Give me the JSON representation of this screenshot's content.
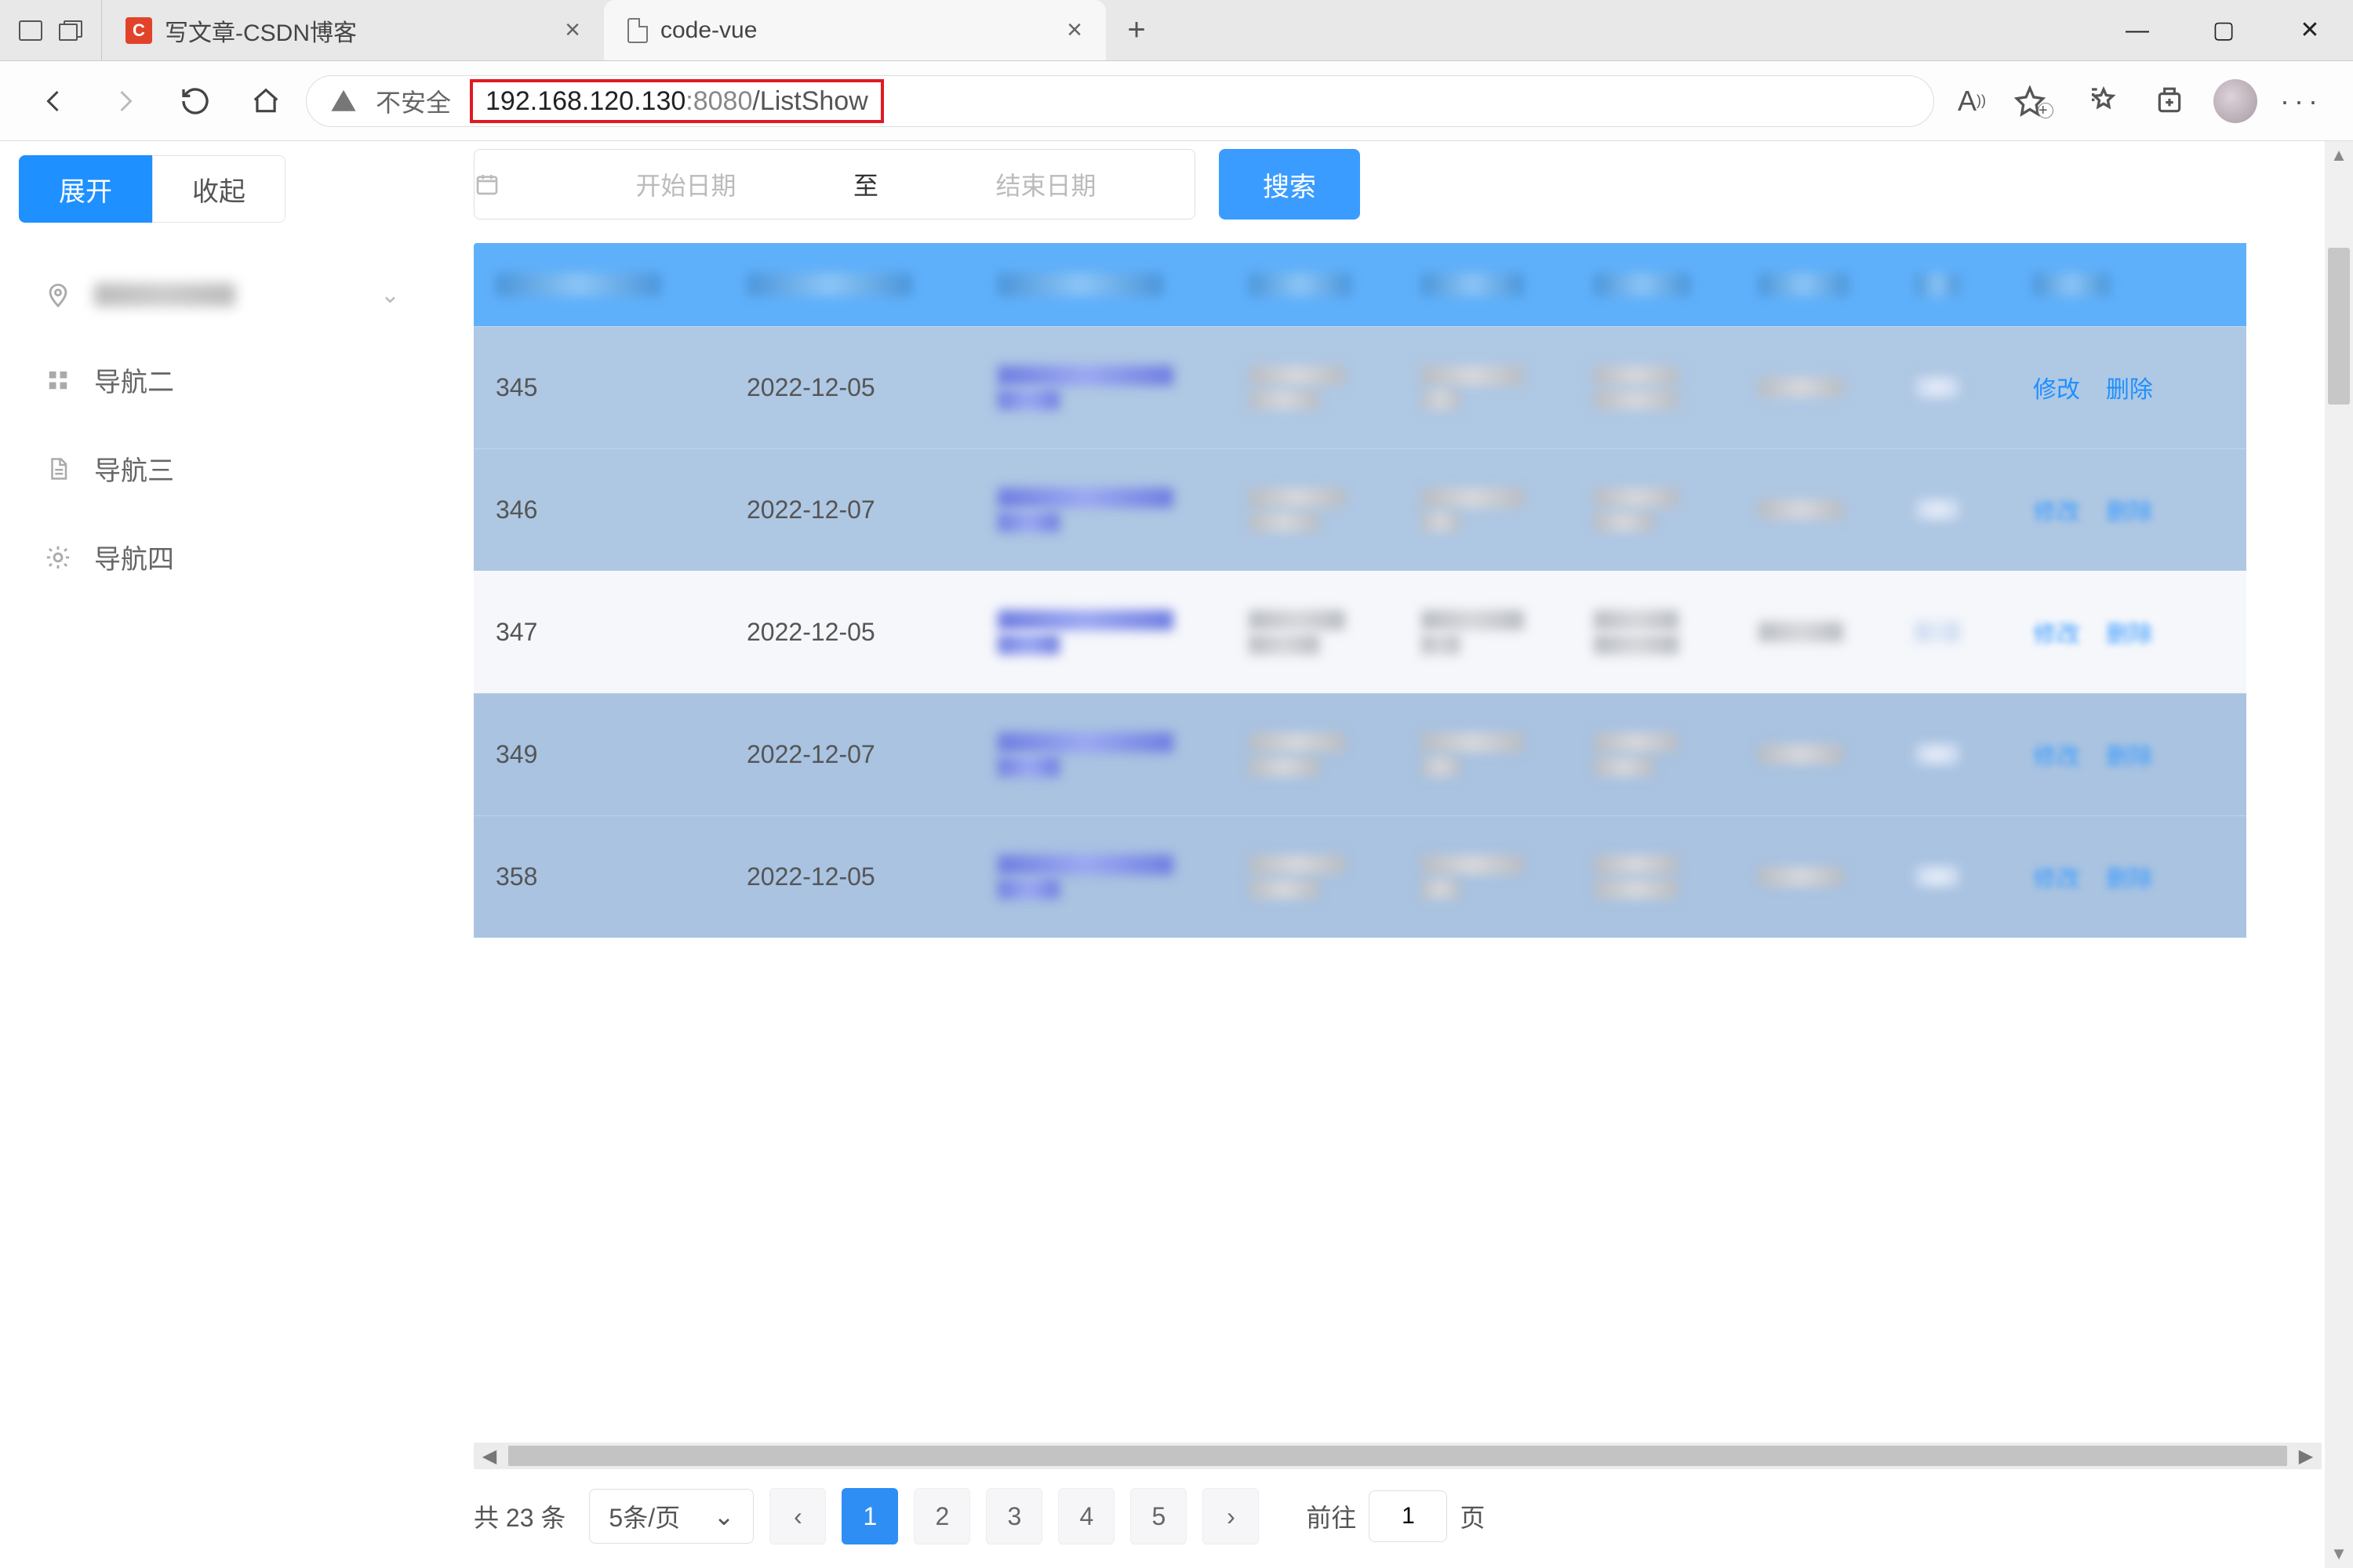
{
  "browser": {
    "tabs": [
      {
        "title": "写文章-CSDN博客",
        "favicon": "csdn"
      },
      {
        "title": "code-vue",
        "favicon": "doc"
      }
    ],
    "active_tab": 1,
    "url": {
      "insecure_label": "不安全",
      "host": "192.168.120.130",
      "port": ":8080",
      "path": "/ListShow"
    }
  },
  "sidebar": {
    "expand": "展开",
    "collapse": "收起",
    "items": [
      {
        "label": "",
        "icon": "pin",
        "has_children": true
      },
      {
        "label": "导航二",
        "icon": "grid"
      },
      {
        "label": "导航三",
        "icon": "doc"
      },
      {
        "label": "导航四",
        "icon": "gear"
      }
    ]
  },
  "toolbar": {
    "start_placeholder": "开始日期",
    "range_sep": "至",
    "end_placeholder": "结束日期",
    "search": "搜索"
  },
  "table": {
    "rows": [
      {
        "id": "345",
        "date": "2022-12-05",
        "edit": "修改",
        "del": "删除",
        "blur_ops": false
      },
      {
        "id": "346",
        "date": "2022-12-07",
        "edit": "修改",
        "del": "删除",
        "blur_ops": true
      },
      {
        "id": "347",
        "date": "2022-12-05",
        "edit": "修改",
        "del": "删除",
        "blur_ops": true
      },
      {
        "id": "349",
        "date": "2022-12-07",
        "edit": "修改",
        "del": "删除",
        "blur_ops": true
      },
      {
        "id": "358",
        "date": "2022-12-05",
        "edit": "修改",
        "del": "删除",
        "blur_ops": true
      }
    ]
  },
  "pagination": {
    "total_prefix": "共",
    "total_count": "23",
    "total_suffix": "条",
    "page_size": "5条/页",
    "pages": [
      "1",
      "2",
      "3",
      "4",
      "5"
    ],
    "active": "1",
    "goto_prefix": "前往",
    "goto_value": "1",
    "goto_suffix": "页"
  }
}
